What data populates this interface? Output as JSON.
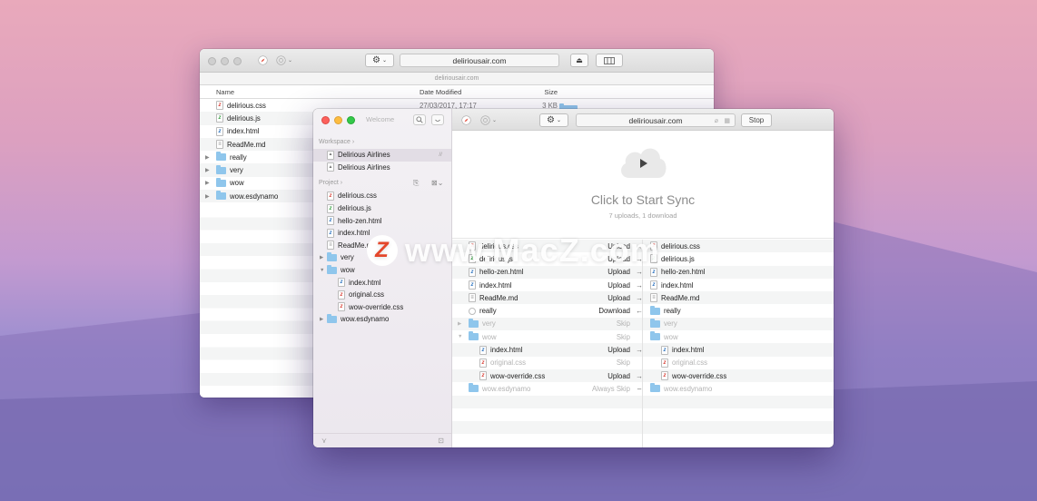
{
  "back_window": {
    "address": "deliriousair.com",
    "path_label": "deliriousair.com",
    "columns": {
      "name": "Name",
      "date": "Date Modified",
      "size": "Size"
    },
    "rows": [
      {
        "name": "delirious.css",
        "date": "27/03/2017, 17:17",
        "size": "3 KB",
        "icon": "css-file-icon"
      },
      {
        "name": "delirious.js",
        "date": "",
        "size": "",
        "icon": "js-file-icon"
      },
      {
        "name": "index.html",
        "date": "",
        "size": "",
        "icon": "html-file-icon"
      },
      {
        "name": "ReadMe.md",
        "date": "",
        "size": "",
        "icon": "md-file-icon"
      },
      {
        "name": "really",
        "date": "",
        "size": "",
        "icon": "folder-icon"
      },
      {
        "name": "very",
        "date": "",
        "size": "",
        "icon": "folder-icon"
      },
      {
        "name": "wow",
        "date": "",
        "size": "",
        "icon": "folder-icon"
      },
      {
        "name": "wow.esdynamo",
        "date": "",
        "size": "",
        "icon": "folder-icon"
      }
    ]
  },
  "front_window": {
    "sidebar": {
      "welcome_label": "Welcome",
      "workspace_heading": "Workspace ›",
      "workspace_items": [
        {
          "label": "Delirious Airlines",
          "badge": "//"
        },
        {
          "label": "Delirious Airlines",
          "badge": ""
        }
      ],
      "project_heading": "Project ›",
      "project_items": [
        {
          "label": "delirious.css",
          "kind": "css"
        },
        {
          "label": "delirious.js",
          "kind": "js"
        },
        {
          "label": "hello-zen.html",
          "kind": "html"
        },
        {
          "label": "index.html",
          "kind": "html"
        },
        {
          "label": "ReadMe.md",
          "kind": "md"
        },
        {
          "label": "very",
          "kind": "folder"
        },
        {
          "label": "wow",
          "kind": "folder"
        },
        {
          "label": "index.html",
          "kind": "html"
        },
        {
          "label": "original.css",
          "kind": "css"
        },
        {
          "label": "wow-override.css",
          "kind": "css"
        },
        {
          "label": "wow.esdynamo",
          "kind": "folder"
        }
      ]
    },
    "toolbar": {
      "address": "deliriousair.com",
      "stop_label": "Stop"
    },
    "hero": {
      "title": "Click to Start Sync",
      "subtitle": "7 uploads, 1 download"
    },
    "sync_rows": [
      {
        "left": "delirious.css",
        "action": "Upload",
        "arrow": "→",
        "right": "delirious.css",
        "dim": false,
        "kind": "css"
      },
      {
        "left": "delirious.js",
        "action": "Upload",
        "arrow": "→",
        "right": "delirious.js",
        "dim": false,
        "kind": "js"
      },
      {
        "left": "hello-zen.html",
        "action": "Upload",
        "arrow": "→",
        "right": "hello-zen.html",
        "dim": false,
        "kind": "html"
      },
      {
        "left": "index.html",
        "action": "Upload",
        "arrow": "→",
        "right": "index.html",
        "dim": false,
        "kind": "html"
      },
      {
        "left": "ReadMe.md",
        "action": "Upload",
        "arrow": "→",
        "right": "ReadMe.md",
        "dim": false,
        "kind": "md"
      },
      {
        "left": "really",
        "action": "Download",
        "arrow": "←",
        "right": "really",
        "dim": false,
        "kind": "folder"
      },
      {
        "left": "very",
        "action": "Skip",
        "arrow": "",
        "right": "very",
        "dim": true,
        "kind": "folder"
      },
      {
        "left": "wow",
        "action": "Skip",
        "arrow": "",
        "right": "wow",
        "dim": true,
        "kind": "folder"
      },
      {
        "left": "index.html",
        "action": "Upload",
        "arrow": "→",
        "right": "index.html",
        "dim": false,
        "kind": "html"
      },
      {
        "left": "original.css",
        "action": "Skip",
        "arrow": "",
        "right": "original.css",
        "dim": true,
        "kind": "css"
      },
      {
        "left": "wow-override.css",
        "action": "Upload",
        "arrow": "→",
        "right": "wow-override.css",
        "dim": false,
        "kind": "css"
      },
      {
        "left": "wow.esdynamo",
        "action": "Always Skip",
        "arrow": "–",
        "right": "wow.esdynamo",
        "dim": true,
        "kind": "folder"
      }
    ]
  },
  "watermark": {
    "text": "www.MacZ.com",
    "logo_letter": "Z"
  },
  "colors": {
    "css": "#d9433a",
    "js": "#3aa146",
    "html": "#2f74c0",
    "md": "#888888",
    "folder": "#8fc6ec"
  }
}
